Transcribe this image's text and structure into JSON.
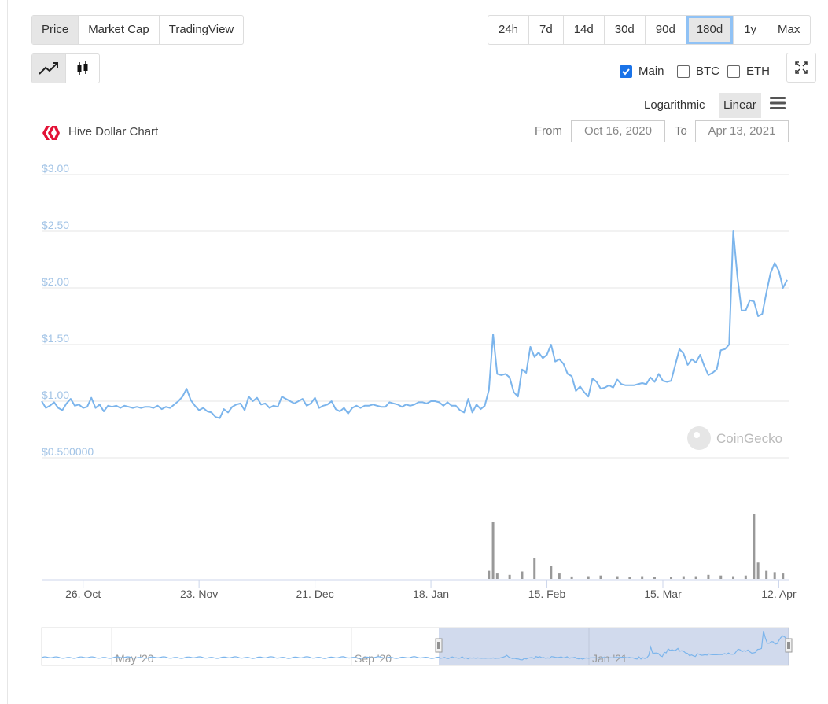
{
  "tabs": [
    "Price",
    "Market Cap",
    "TradingView"
  ],
  "active_tab": 0,
  "ranges": [
    "24h",
    "7d",
    "14d",
    "30d",
    "90d",
    "180d",
    "1y",
    "Max"
  ],
  "active_range": 5,
  "checkboxes": [
    {
      "label": "Main",
      "checked": true
    },
    {
      "label": "BTC",
      "checked": false
    },
    {
      "label": "ETH",
      "checked": false
    }
  ],
  "scales": [
    "Logarithmic",
    "Linear"
  ],
  "active_scale": 1,
  "chart_title": "Hive Dollar Chart",
  "from_label": "From",
  "to_label": "To",
  "from_date": "Oct 16, 2020",
  "to_date": "Apr 13, 2021",
  "watermark": "CoinGecko",
  "colors": {
    "line": "#7cb5ec",
    "volume": "#999999",
    "accent": "#1a73e8",
    "logo": "#e31337"
  },
  "icons": {
    "line_chart": "trend-line-icon",
    "candle_chart": "candlestick-icon",
    "expand": "expand-icon",
    "menu": "hamburger-menu-icon"
  },
  "chart_data": {
    "type": "line",
    "title": "Hive Dollar Chart",
    "ylabel": "",
    "ylim": [
      0.5,
      3.0
    ],
    "yticks": [
      3.0,
      2.5,
      2.0,
      1.5,
      1.0,
      0.5
    ],
    "ytick_labels": [
      "$3.00",
      "$2.50",
      "$2.00",
      "$1.50",
      "$1.00",
      "$0.500000"
    ],
    "xticks": [
      {
        "label": "26. Oct",
        "day": 10
      },
      {
        "label": "23. Nov",
        "day": 38
      },
      {
        "label": "21. Dec",
        "day": 66
      },
      {
        "label": "18. Jan",
        "day": 94
      },
      {
        "label": "15. Feb",
        "day": 122
      },
      {
        "label": "15. Mar",
        "day": 150
      },
      {
        "label": "12. Apr",
        "day": 178
      }
    ],
    "series": [
      {
        "values": [
          1.0,
          0.94,
          0.96,
          0.99,
          0.94,
          0.92,
          0.98,
          1.02,
          0.96,
          0.97,
          0.94,
          0.95,
          1.03,
          0.94,
          0.97,
          0.91,
          0.96,
          0.95,
          0.96,
          0.94,
          0.96,
          0.95,
          0.94,
          0.95,
          0.94,
          0.95,
          0.95,
          0.94,
          0.96,
          0.93,
          0.95,
          0.94,
          0.97,
          1.0,
          1.04,
          1.11,
          1.01,
          0.96,
          0.92,
          0.94,
          0.91,
          0.9,
          0.86,
          0.85,
          0.93,
          0.9,
          0.95,
          0.97,
          0.98,
          0.92,
          1.04,
          1.0,
          1.03,
          0.97,
          0.98,
          0.94,
          0.96,
          0.95,
          1.04,
          1.02,
          1.0,
          0.98,
          1.0,
          1.02,
          0.96,
          0.98,
          1.03,
          0.94,
          0.96,
          0.97,
          1.0,
          0.93,
          0.91,
          0.94,
          0.89,
          0.94,
          0.96,
          0.94,
          0.96,
          0.96,
          0.97,
          0.96,
          0.95,
          0.95,
          0.99,
          0.98,
          0.97,
          0.95,
          0.97,
          0.96,
          0.97,
          0.99,
          0.99,
          0.98,
          1.0,
          1.0,
          0.99,
          0.96,
          0.99,
          0.96,
          0.96,
          0.92,
          0.9,
          1.02,
          0.9,
          0.97,
          0.93,
          0.96,
          1.1,
          1.59,
          1.24,
          1.23,
          1.24,
          1.21,
          1.08,
          1.04,
          1.28,
          1.25,
          1.48,
          1.39,
          1.43,
          1.38,
          1.41,
          1.5,
          1.35,
          1.37,
          1.33,
          1.24,
          1.22,
          1.09,
          1.13,
          1.08,
          1.04,
          1.2,
          1.17,
          1.11,
          1.12,
          1.14,
          1.12,
          1.19,
          1.15,
          1.14,
          1.14,
          1.14,
          1.15,
          1.16,
          1.15,
          1.21,
          1.17,
          1.24,
          1.18,
          1.17,
          1.18,
          1.32,
          1.46,
          1.42,
          1.32,
          1.37,
          1.34,
          1.41,
          1.31,
          1.23,
          1.25,
          1.28,
          1.45,
          1.46,
          1.5,
          2.5,
          2.1,
          1.8,
          1.8,
          1.89,
          1.88,
          1.75,
          1.77,
          1.96,
          2.13,
          2.22,
          2.15,
          2.0,
          2.07
        ]
      }
    ],
    "volume": [
      {
        "day": 108,
        "value": 60
      },
      {
        "day": 109,
        "value": 420
      },
      {
        "day": 110,
        "value": 40
      },
      {
        "day": 113,
        "value": 30
      },
      {
        "day": 116,
        "value": 55
      },
      {
        "day": 119,
        "value": 155
      },
      {
        "day": 123,
        "value": 95
      },
      {
        "day": 125,
        "value": 40
      },
      {
        "day": 128,
        "value": 18
      },
      {
        "day": 132,
        "value": 20
      },
      {
        "day": 135,
        "value": 25
      },
      {
        "day": 139,
        "value": 20
      },
      {
        "day": 142,
        "value": 15
      },
      {
        "day": 145,
        "value": 20
      },
      {
        "day": 148,
        "value": 15
      },
      {
        "day": 152,
        "value": 15
      },
      {
        "day": 155,
        "value": 20
      },
      {
        "day": 158,
        "value": 20
      },
      {
        "day": 161,
        "value": 30
      },
      {
        "day": 164,
        "value": 25
      },
      {
        "day": 167,
        "value": 20
      },
      {
        "day": 170,
        "value": 25
      },
      {
        "day": 172,
        "value": 480
      },
      {
        "day": 173,
        "value": 120
      },
      {
        "day": 175,
        "value": 60
      },
      {
        "day": 177,
        "value": 50
      },
      {
        "day": 179,
        "value": 40
      }
    ],
    "navigator": {
      "xticks": [
        "May '20",
        "Sep '20",
        "Jan '21"
      ],
      "selection": {
        "from": "Oct 16, 2020",
        "to": "Apr 13, 2021"
      }
    }
  }
}
